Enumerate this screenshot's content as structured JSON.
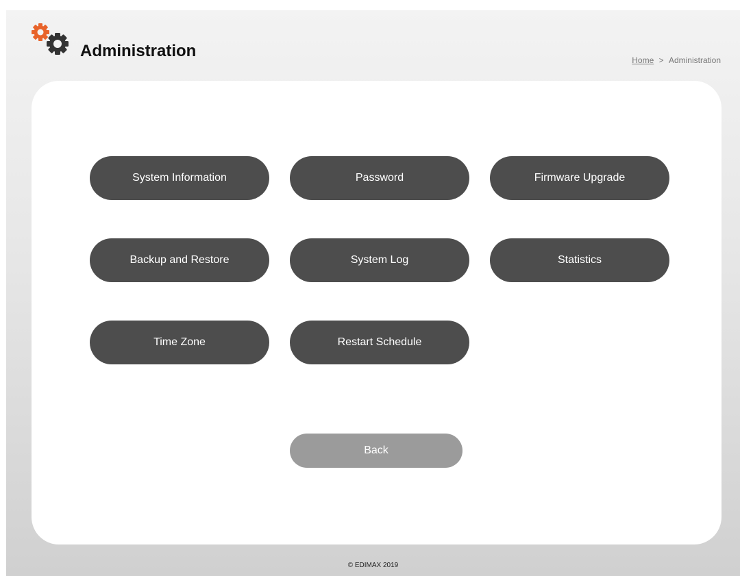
{
  "header": {
    "title": "Administration",
    "logo_icon": "gears-icon",
    "colors": {
      "accent_gear": "#e8632a",
      "dark_gear": "#333333"
    }
  },
  "breadcrumb": {
    "home": "Home",
    "separator": ">",
    "current": "Administration"
  },
  "menu": {
    "system_information": "System Information",
    "password": "Password",
    "firmware_upgrade": "Firmware Upgrade",
    "backup_and_restore": "Backup and Restore",
    "system_log": "System Log",
    "statistics": "Statistics",
    "time_zone": "Time Zone",
    "restart_schedule": "Restart Schedule"
  },
  "back_label": "Back",
  "footer": {
    "copyright": "© EDIMAX 2019"
  },
  "colors": {
    "button_bg": "#4d4d4d",
    "back_button_bg": "#9b9b9b",
    "panel_bg": "#ffffff"
  }
}
